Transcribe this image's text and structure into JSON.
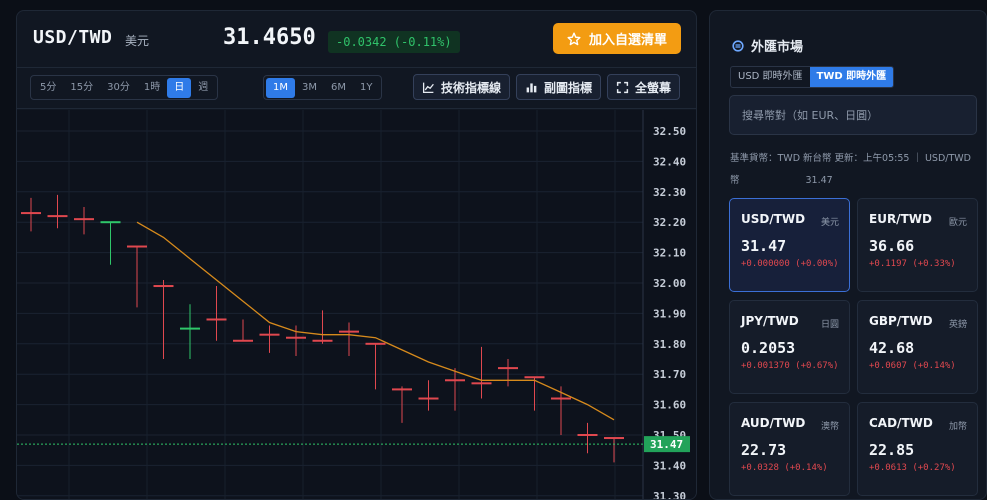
{
  "header": {
    "pair": "USD/TWD",
    "pair_name": "美元",
    "price": "31.4650",
    "change": "-0.0342 (-0.11%)",
    "watch_label": "加入自選清單"
  },
  "toolbar": {
    "timeframes": [
      "5分",
      "15分",
      "30分",
      "1時",
      "日",
      "週"
    ],
    "timeframe_active": 4,
    "ranges": [
      "1M",
      "3M",
      "6M",
      "1Y"
    ],
    "range_active": 0,
    "tech_label": "技術指標線",
    "sub_label": "副圖指標",
    "full_label": "全螢幕"
  },
  "chart_data": {
    "type": "candlestick",
    "y_ticks": [
      "32.50",
      "32.40",
      "32.30",
      "32.20",
      "32.10",
      "32.00",
      "31.90",
      "31.80",
      "31.70",
      "31.60",
      "31.50",
      "31.40",
      "31.30"
    ],
    "ylim": [
      31.3,
      32.5
    ],
    "current_price_label": "31.47",
    "current_price": 31.47,
    "candles": [
      {
        "o": 32.23,
        "c": 32.23,
        "h": 32.28,
        "l": 32.17
      },
      {
        "o": 32.22,
        "c": 32.22,
        "h": 32.29,
        "l": 32.18
      },
      {
        "o": 32.21,
        "c": 32.21,
        "h": 32.25,
        "l": 32.16
      },
      {
        "o": 32.2,
        "c": 32.2,
        "h": 32.2,
        "l": 32.06
      },
      {
        "o": 32.12,
        "c": 32.12,
        "h": 32.12,
        "l": 31.92
      },
      {
        "o": 31.99,
        "c": 31.99,
        "h": 32.01,
        "l": 31.75
      },
      {
        "o": 31.85,
        "c": 31.85,
        "h": 31.93,
        "l": 31.75
      },
      {
        "o": 31.88,
        "c": 31.88,
        "h": 31.99,
        "l": 31.81
      },
      {
        "o": 31.81,
        "c": 31.81,
        "h": 31.88,
        "l": 31.81
      },
      {
        "o": 31.83,
        "c": 31.83,
        "h": 31.86,
        "l": 31.77
      },
      {
        "o": 31.82,
        "c": 31.82,
        "h": 31.86,
        "l": 31.76
      },
      {
        "o": 31.81,
        "c": 31.81,
        "h": 31.91,
        "l": 31.8
      },
      {
        "o": 31.84,
        "c": 31.84,
        "h": 31.87,
        "l": 31.76
      },
      {
        "o": 31.8,
        "c": 31.8,
        "h": 31.8,
        "l": 31.65
      },
      {
        "o": 31.65,
        "c": 31.65,
        "h": 31.66,
        "l": 31.54
      },
      {
        "o": 31.62,
        "c": 31.62,
        "h": 31.68,
        "l": 31.58
      },
      {
        "o": 31.68,
        "c": 31.68,
        "h": 31.72,
        "l": 31.58
      },
      {
        "o": 31.67,
        "c": 31.67,
        "h": 31.79,
        "l": 31.62
      },
      {
        "o": 31.72,
        "c": 31.72,
        "h": 31.75,
        "l": 31.66
      },
      {
        "o": 31.69,
        "c": 31.69,
        "h": 31.69,
        "l": 31.58
      },
      {
        "o": 31.62,
        "c": 31.62,
        "h": 31.66,
        "l": 31.5
      },
      {
        "o": 31.5,
        "c": 31.5,
        "h": 31.54,
        "l": 31.44
      },
      {
        "o": 31.49,
        "c": 31.49,
        "h": 31.49,
        "l": 31.41
      }
    ],
    "candle_colors": [
      "#e0484f",
      "#e0484f",
      "#e0484f",
      "#2fc66a",
      "#e0484f",
      "#e0484f",
      "#2fc66a",
      "#e0484f",
      "#e0484f",
      "#e0484f",
      "#e0484f",
      "#e0484f",
      "#e0484f",
      "#e0484f",
      "#e0484f",
      "#e0484f",
      "#e0484f",
      "#e0484f",
      "#e0484f",
      "#e0484f",
      "#e0484f",
      "#e0484f",
      "#e0484f"
    ],
    "ma_line": [
      null,
      null,
      null,
      null,
      32.2,
      32.15,
      32.08,
      32.01,
      31.94,
      31.87,
      31.84,
      31.83,
      31.83,
      31.82,
      31.78,
      31.74,
      31.71,
      31.68,
      31.68,
      31.68,
      31.64,
      31.6,
      31.55
    ],
    "ma_color": "#d68a1c",
    "up_color": "#2fc66a",
    "down_color": "#e0484f"
  },
  "market": {
    "title": "外匯市場",
    "tabs": [
      "USD 即時外匯",
      "TWD 即時外匯"
    ],
    "tab_active": 1,
    "search_placeholder": "搜尋幣對（如 EUR、日圓）",
    "base_line": "基準貨幣：TWD 新台幣 更新：上午05:55 ｜ USD/TWD",
    "base_line2": "幣",
    "base_rate": "31.47",
    "cards": [
      {
        "pair": "USD/TWD",
        "name": "美元",
        "value": "31.47",
        "change": "+0.000000 (+0.00%)",
        "selected": true
      },
      {
        "pair": "EUR/TWD",
        "name": "歐元",
        "value": "36.66",
        "change": "+0.1197 (+0.33%)",
        "selected": false
      },
      {
        "pair": "JPY/TWD",
        "name": "日圓",
        "value": "0.2053",
        "change": "+0.001370 (+0.67%)",
        "selected": false
      },
      {
        "pair": "GBP/TWD",
        "name": "英鎊",
        "value": "42.68",
        "change": "+0.0607 (+0.14%)",
        "selected": false
      },
      {
        "pair": "AUD/TWD",
        "name": "澳幣",
        "value": "22.73",
        "change": "+0.0328 (+0.14%)",
        "selected": false
      },
      {
        "pair": "CAD/TWD",
        "name": "加幣",
        "value": "22.85",
        "change": "+0.0613 (+0.27%)",
        "selected": false
      }
    ]
  }
}
